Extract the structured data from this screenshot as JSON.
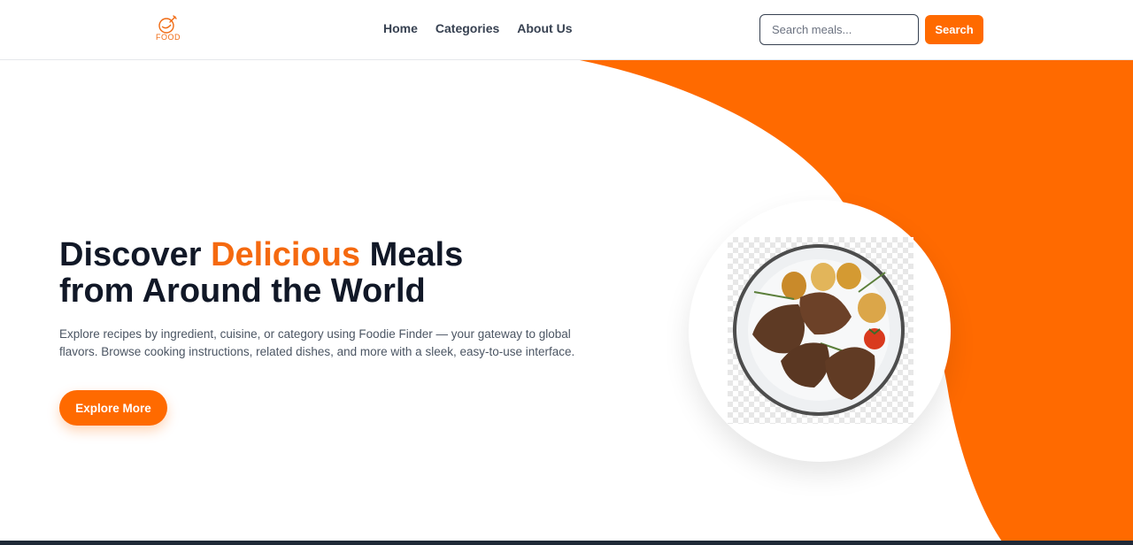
{
  "brand": {
    "logo_text": "FOOD",
    "accent_color": "#ff6a00"
  },
  "nav": {
    "items": [
      "Home",
      "Categories",
      "About Us"
    ]
  },
  "search": {
    "placeholder": "Search meals...",
    "button_label": "Search"
  },
  "hero": {
    "title_part1": "Discover ",
    "title_accent": "Delicious",
    "title_part2": " Meals from Around the World",
    "description": "Explore recipes by ingredient, cuisine, or category using Foodie Finder — your gateway to global flavors. Browse cooking instructions, related dishes, and more with a sleek, easy-to-use interface.",
    "cta_label": "Explore More",
    "image_alt": "plate-of-grilled-meat-with-potatoes"
  },
  "icons": [
    "food-logo-icon"
  ]
}
